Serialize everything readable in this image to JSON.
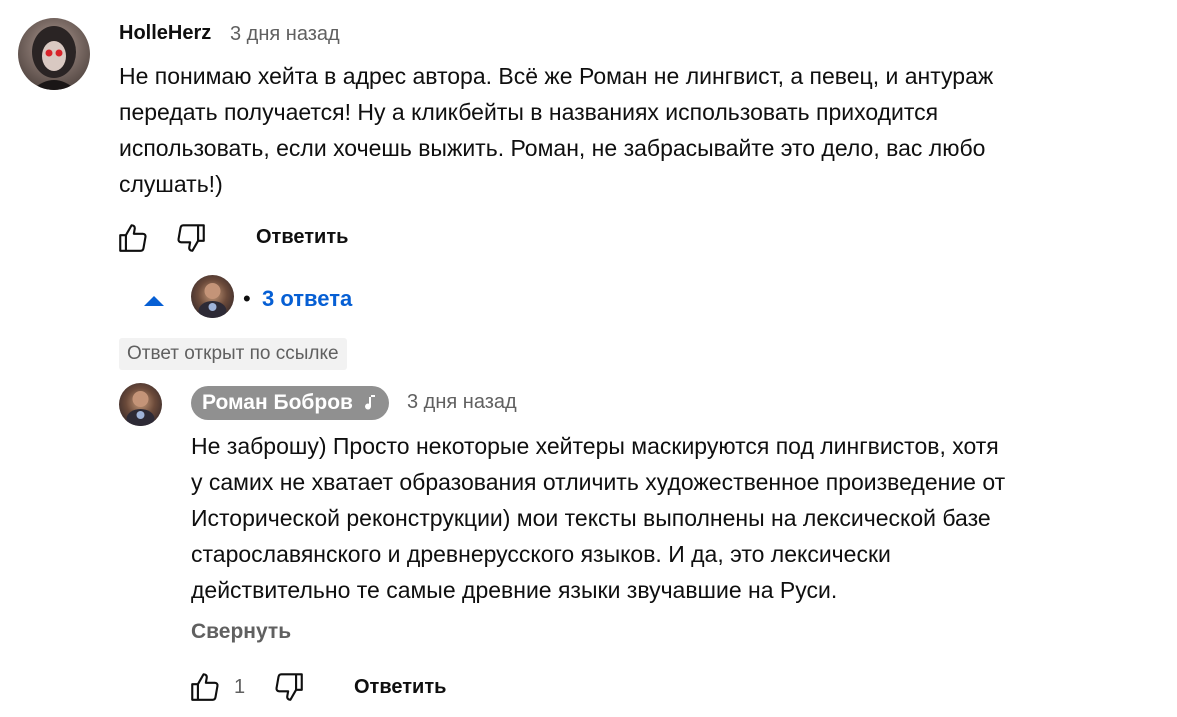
{
  "comment": {
    "author": "HolleHerz",
    "timestamp": "3 дня назад",
    "text": "Не понимаю хейта в адрес автора. Всё же Роман не лингвист, а певец, и антураж\nпередать получается! Ну а кликбейты в названиях использовать приходится\nиспользовать, если хочешь выжить. Роман, не забрасывайте это дело, вас любо\nслушать!)",
    "actions": {
      "like_icon": "thumbs-up-icon",
      "dislike_icon": "thumbs-down-icon",
      "reply_label": "Ответить"
    },
    "replies_toggle": {
      "icon": "caret-up-icon",
      "separator": "•",
      "label": "3 ответа"
    }
  },
  "linked_badge": "Ответ открыт по ссылке",
  "reply": {
    "author": "Роман Бобров",
    "author_badge_icon": "music-note-icon",
    "timestamp": "3 дня назад",
    "text": "Не заброшу) Просто некоторые хейтеры маскируются под лингвистов, хотя\nу самих не хватает образования отличить художественное произведение от\nИсторической реконструкции) мои тексты выполнены на лексической базе\nстарославянского и древнерусского языков. И да, это лексически\nдействительно те самые древние языки звучавшие на Руси.",
    "collapse_label": "Свернуть",
    "like_count": "1",
    "reply_label": "Ответить"
  },
  "colors": {
    "link_blue": "#065fd4",
    "secondary_text": "#606060",
    "chip_gray": "#909090",
    "badge_bg": "#f2f2f2"
  }
}
